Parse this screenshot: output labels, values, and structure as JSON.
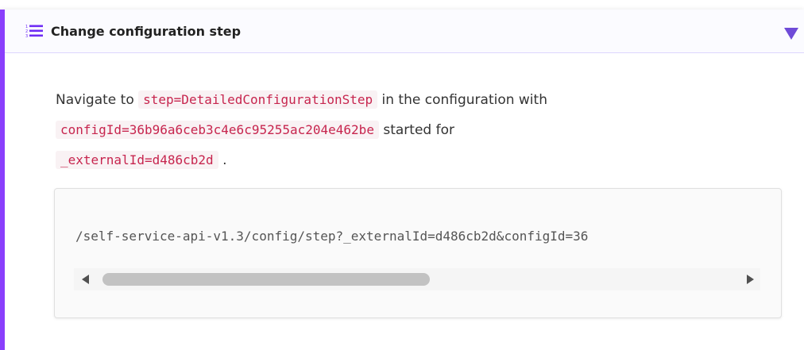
{
  "header": {
    "title": "Change configuration step",
    "icon": "numbered-list-icon",
    "toggle_icon": "triangle-down-icon",
    "accent_color": "#8a3ffc"
  },
  "body": {
    "text_navigate": "Navigate to",
    "code_step": "step=DetailedConfigurationStep",
    "text_in_config": "in the configuration with",
    "code_config_id": "configId=36b96a6ceb3c4e6c95255ac204e462be",
    "text_started_for": "started for",
    "code_external_id": "_externalId=d486cb2d",
    "text_period": "."
  },
  "code_block": {
    "line": "/self-service-api-v1.3/config/step?_externalId=d486cb2d&configId=36"
  }
}
